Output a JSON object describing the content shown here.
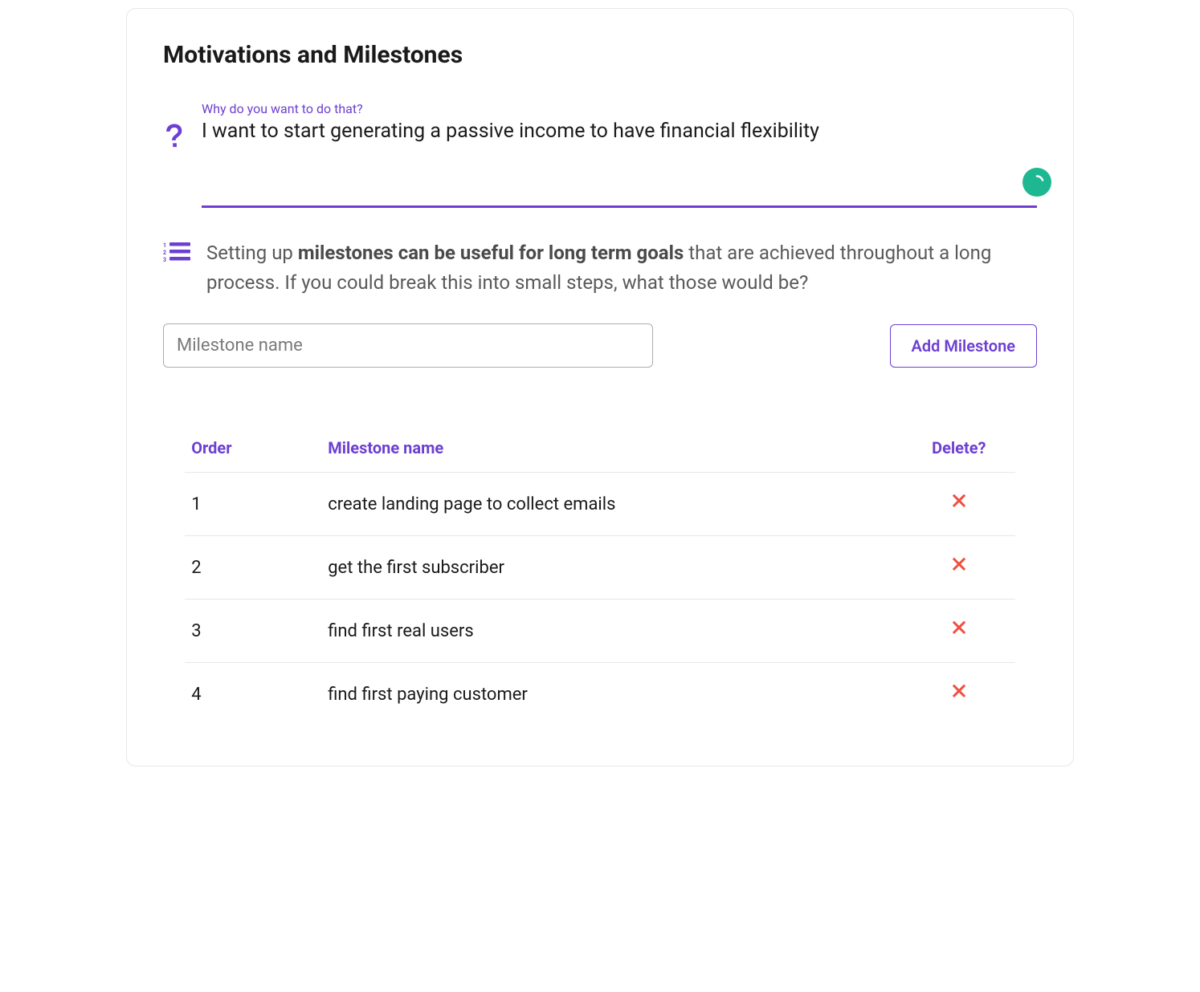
{
  "title": "Motivations and Milestones",
  "motivation": {
    "label": "Why do you want to do that?",
    "value": "I want to start generating a passive income to have financial flexibility"
  },
  "intro": {
    "prefix": "Setting up ",
    "bold": "milestones can be useful for long term goals",
    "suffix": " that are achieved throughout a long process. If you could break this into small steps, what those would be?"
  },
  "milestone_input": {
    "placeholder": "Milestone name",
    "value": ""
  },
  "add_button_label": "Add Milestone",
  "table": {
    "headers": {
      "order": "Order",
      "name": "Milestone name",
      "delete": "Delete?"
    },
    "rows": [
      {
        "order": "1",
        "name": "create landing page to collect emails"
      },
      {
        "order": "2",
        "name": "get the first subscriber"
      },
      {
        "order": "3",
        "name": "find first real users"
      },
      {
        "order": "4",
        "name": "find first paying customer"
      }
    ]
  }
}
